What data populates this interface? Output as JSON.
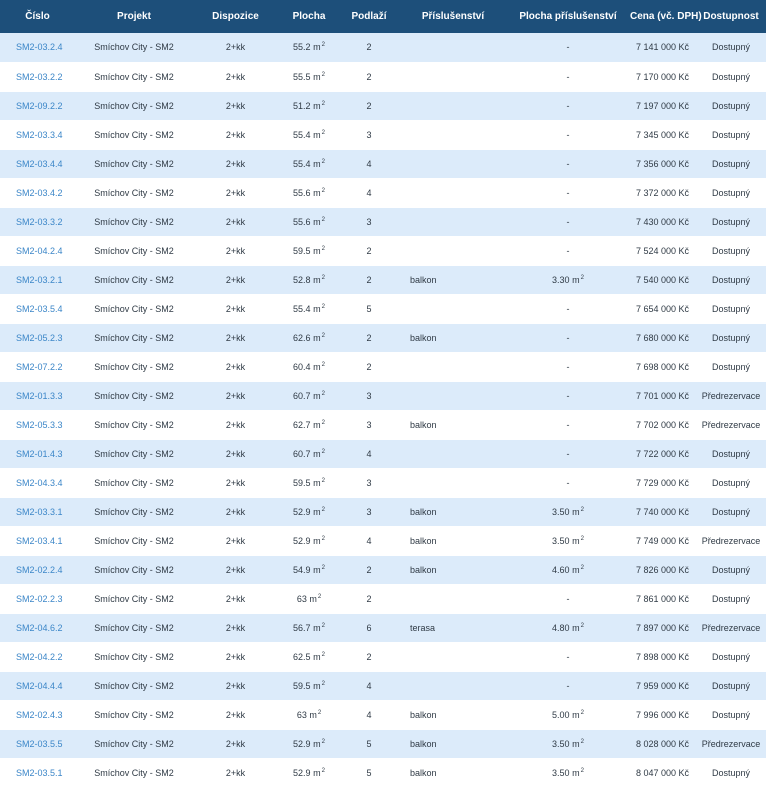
{
  "colors": {
    "header_bg": "#1d4f7a",
    "row_alt": "#dcebfa",
    "link": "#3b86c8"
  },
  "table": {
    "headers": [
      "Číslo",
      "Projekt",
      "Dispozice",
      "Plocha",
      "Podlaží",
      "Příslušenství",
      "Plocha příslušenství",
      "Cena (vč. DPH)",
      "Dostupnost"
    ],
    "unit": "m",
    "unit_sup": "2",
    "rows": [
      {
        "cislo": "SM2-03.2.4",
        "projekt": "Smíchov City - SM2",
        "dispozice": "2+kk",
        "plocha": "55.2",
        "podlazi": "2",
        "prislusenstvi": "",
        "plocha_pris": "-",
        "cena": "7 141 000 Kč",
        "dostupnost": "Dostupný"
      },
      {
        "cislo": "SM2-03.2.2",
        "projekt": "Smíchov City - SM2",
        "dispozice": "2+kk",
        "plocha": "55.5",
        "podlazi": "2",
        "prislusenstvi": "",
        "plocha_pris": "-",
        "cena": "7 170 000 Kč",
        "dostupnost": "Dostupný"
      },
      {
        "cislo": "SM2-09.2.2",
        "projekt": "Smíchov City - SM2",
        "dispozice": "2+kk",
        "plocha": "51.2",
        "podlazi": "2",
        "prislusenstvi": "",
        "plocha_pris": "-",
        "cena": "7 197 000 Kč",
        "dostupnost": "Dostupný"
      },
      {
        "cislo": "SM2-03.3.4",
        "projekt": "Smíchov City - SM2",
        "dispozice": "2+kk",
        "plocha": "55.4",
        "podlazi": "3",
        "prislusenstvi": "",
        "plocha_pris": "-",
        "cena": "7 345 000 Kč",
        "dostupnost": "Dostupný"
      },
      {
        "cislo": "SM2-03.4.4",
        "projekt": "Smíchov City - SM2",
        "dispozice": "2+kk",
        "plocha": "55.4",
        "podlazi": "4",
        "prislusenstvi": "",
        "plocha_pris": "-",
        "cena": "7 356 000 Kč",
        "dostupnost": "Dostupný"
      },
      {
        "cislo": "SM2-03.4.2",
        "projekt": "Smíchov City - SM2",
        "dispozice": "2+kk",
        "plocha": "55.6",
        "podlazi": "4",
        "prislusenstvi": "",
        "plocha_pris": "-",
        "cena": "7 372 000 Kč",
        "dostupnost": "Dostupný"
      },
      {
        "cislo": "SM2-03.3.2",
        "projekt": "Smíchov City - SM2",
        "dispozice": "2+kk",
        "plocha": "55.6",
        "podlazi": "3",
        "prislusenstvi": "",
        "plocha_pris": "-",
        "cena": "7 430 000 Kč",
        "dostupnost": "Dostupný"
      },
      {
        "cislo": "SM2-04.2.4",
        "projekt": "Smíchov City - SM2",
        "dispozice": "2+kk",
        "plocha": "59.5",
        "podlazi": "2",
        "prislusenstvi": "",
        "plocha_pris": "-",
        "cena": "7 524 000 Kč",
        "dostupnost": "Dostupný"
      },
      {
        "cislo": "SM2-03.2.1",
        "projekt": "Smíchov City - SM2",
        "dispozice": "2+kk",
        "plocha": "52.8",
        "podlazi": "2",
        "prislusenstvi": "balkon",
        "plocha_pris": "3.30",
        "cena": "7 540 000 Kč",
        "dostupnost": "Dostupný"
      },
      {
        "cislo": "SM2-03.5.4",
        "projekt": "Smíchov City - SM2",
        "dispozice": "2+kk",
        "plocha": "55.4",
        "podlazi": "5",
        "prislusenstvi": "",
        "plocha_pris": "-",
        "cena": "7 654 000 Kč",
        "dostupnost": "Dostupný"
      },
      {
        "cislo": "SM2-05.2.3",
        "projekt": "Smíchov City - SM2",
        "dispozice": "2+kk",
        "plocha": "62.6",
        "podlazi": "2",
        "prislusenstvi": "balkon",
        "plocha_pris": "-",
        "cena": "7 680 000 Kč",
        "dostupnost": "Dostupný"
      },
      {
        "cislo": "SM2-07.2.2",
        "projekt": "Smíchov City - SM2",
        "dispozice": "2+kk",
        "plocha": "60.4",
        "podlazi": "2",
        "prislusenstvi": "",
        "plocha_pris": "-",
        "cena": "7 698 000 Kč",
        "dostupnost": "Dostupný"
      },
      {
        "cislo": "SM2-01.3.3",
        "projekt": "Smíchov City - SM2",
        "dispozice": "2+kk",
        "plocha": "60.7",
        "podlazi": "3",
        "prislusenstvi": "",
        "plocha_pris": "-",
        "cena": "7 701 000 Kč",
        "dostupnost": "Předrezervace"
      },
      {
        "cislo": "SM2-05.3.3",
        "projekt": "Smíchov City - SM2",
        "dispozice": "2+kk",
        "plocha": "62.7",
        "podlazi": "3",
        "prislusenstvi": "balkon",
        "plocha_pris": "-",
        "cena": "7 702 000 Kč",
        "dostupnost": "Předrezervace"
      },
      {
        "cislo": "SM2-01.4.3",
        "projekt": "Smíchov City - SM2",
        "dispozice": "2+kk",
        "plocha": "60.7",
        "podlazi": "4",
        "prislusenstvi": "",
        "plocha_pris": "-",
        "cena": "7 722 000 Kč",
        "dostupnost": "Dostupný"
      },
      {
        "cislo": "SM2-04.3.4",
        "projekt": "Smíchov City - SM2",
        "dispozice": "2+kk",
        "plocha": "59.5",
        "podlazi": "3",
        "prislusenstvi": "",
        "plocha_pris": "-",
        "cena": "7 729 000 Kč",
        "dostupnost": "Dostupný"
      },
      {
        "cislo": "SM2-03.3.1",
        "projekt": "Smíchov City - SM2",
        "dispozice": "2+kk",
        "plocha": "52.9",
        "podlazi": "3",
        "prislusenstvi": "balkon",
        "plocha_pris": "3.50",
        "cena": "7 740 000 Kč",
        "dostupnost": "Dostupný"
      },
      {
        "cislo": "SM2-03.4.1",
        "projekt": "Smíchov City - SM2",
        "dispozice": "2+kk",
        "plocha": "52.9",
        "podlazi": "4",
        "prislusenstvi": "balkon",
        "plocha_pris": "3.50",
        "cena": "7 749 000 Kč",
        "dostupnost": "Předrezervace"
      },
      {
        "cislo": "SM2-02.2.4",
        "projekt": "Smíchov City - SM2",
        "dispozice": "2+kk",
        "plocha": "54.9",
        "podlazi": "2",
        "prislusenstvi": "balkon",
        "plocha_pris": "4.60",
        "cena": "7 826 000 Kč",
        "dostupnost": "Dostupný"
      },
      {
        "cislo": "SM2-02.2.3",
        "projekt": "Smíchov City - SM2",
        "dispozice": "2+kk",
        "plocha": "63",
        "podlazi": "2",
        "prislusenstvi": "",
        "plocha_pris": "-",
        "cena": "7 861 000 Kč",
        "dostupnost": "Dostupný"
      },
      {
        "cislo": "SM2-04.6.2",
        "projekt": "Smíchov City - SM2",
        "dispozice": "2+kk",
        "plocha": "56.7",
        "podlazi": "6",
        "prislusenstvi": "terasa",
        "plocha_pris": "4.80",
        "cena": "7 897 000 Kč",
        "dostupnost": "Předrezervace"
      },
      {
        "cislo": "SM2-04.2.2",
        "projekt": "Smíchov City - SM2",
        "dispozice": "2+kk",
        "plocha": "62.5",
        "podlazi": "2",
        "prislusenstvi": "",
        "plocha_pris": "-",
        "cena": "7 898 000 Kč",
        "dostupnost": "Dostupný"
      },
      {
        "cislo": "SM2-04.4.4",
        "projekt": "Smíchov City - SM2",
        "dispozice": "2+kk",
        "plocha": "59.5",
        "podlazi": "4",
        "prislusenstvi": "",
        "plocha_pris": "-",
        "cena": "7 959 000 Kč",
        "dostupnost": "Dostupný"
      },
      {
        "cislo": "SM2-02.4.3",
        "projekt": "Smíchov City - SM2",
        "dispozice": "2+kk",
        "plocha": "63",
        "podlazi": "4",
        "prislusenstvi": "balkon",
        "plocha_pris": "5.00",
        "cena": "7 996 000 Kč",
        "dostupnost": "Dostupný"
      },
      {
        "cislo": "SM2-03.5.5",
        "projekt": "Smíchov City - SM2",
        "dispozice": "2+kk",
        "plocha": "52.9",
        "podlazi": "5",
        "prislusenstvi": "balkon",
        "plocha_pris": "3.50",
        "cena": "8 028 000 Kč",
        "dostupnost": "Předrezervace"
      },
      {
        "cislo": "SM2-03.5.1",
        "projekt": "Smíchov City - SM2",
        "dispozice": "2+kk",
        "plocha": "52.9",
        "podlazi": "5",
        "prislusenstvi": "balkon",
        "plocha_pris": "3.50",
        "cena": "8 047 000 Kč",
        "dostupnost": "Dostupný"
      }
    ]
  }
}
